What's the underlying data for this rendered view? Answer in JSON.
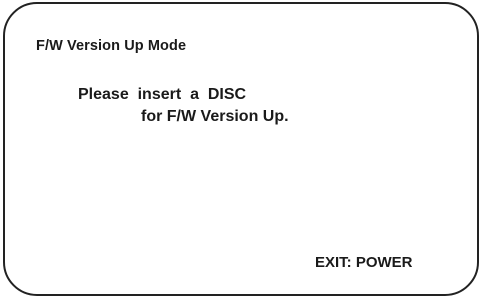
{
  "screen": {
    "title": "F/W Version Up Mode",
    "message_line1": "Please  insert  a  DISC",
    "message_line2": "for F/W Version Up.",
    "exit_hint": "EXIT: POWER"
  },
  "colors": {
    "background": "#ffffff",
    "text": "#1a1a1a",
    "frame": "#222222"
  }
}
